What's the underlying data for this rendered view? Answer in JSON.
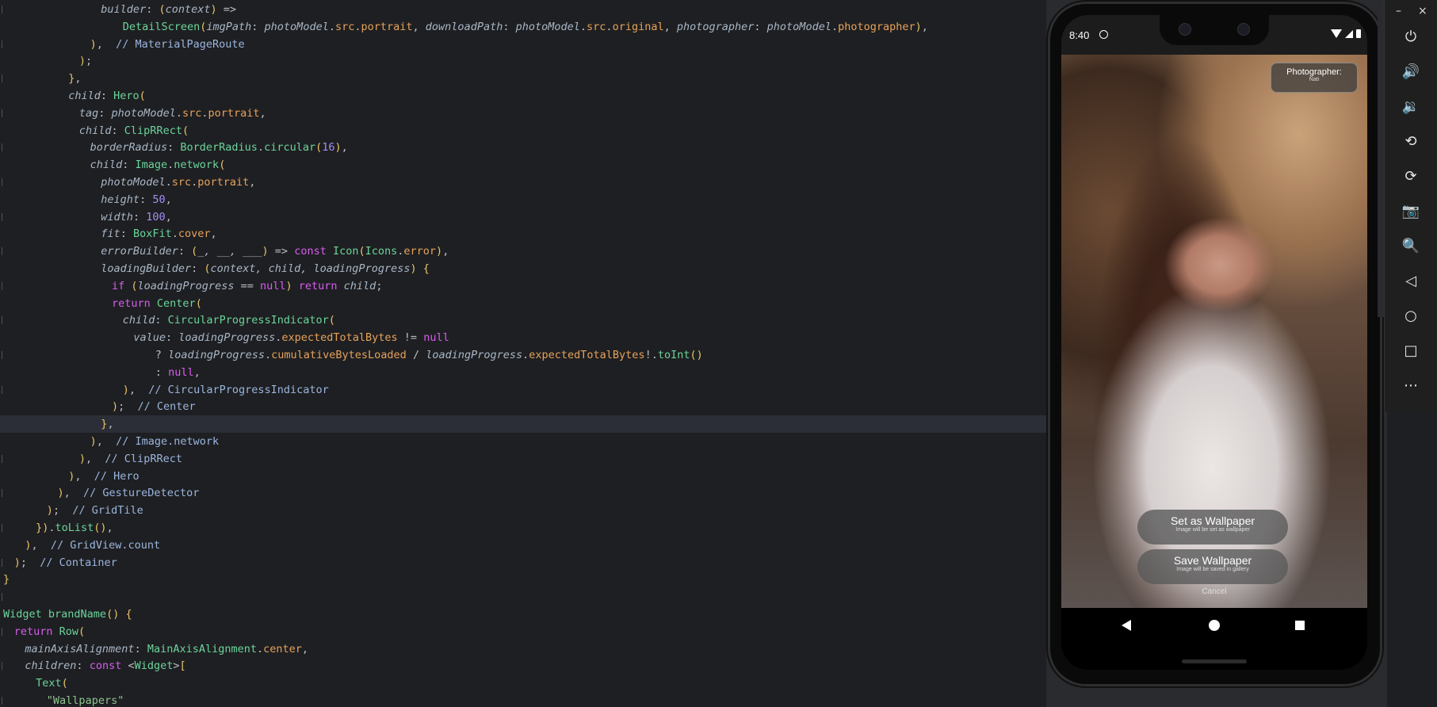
{
  "editor": {
    "lines": [
      {
        "indent": 9,
        "tokens": [
          [
            "p",
            "builder"
          ],
          [
            "i",
            ": "
          ],
          [
            "pa",
            "("
          ],
          [
            "p",
            "context"
          ],
          [
            "pa",
            ")"
          ],
          [
            "i",
            " =>"
          ]
        ]
      },
      {
        "indent": 11,
        "tokens": [
          [
            "c",
            "DetailScreen"
          ],
          [
            "pa",
            "("
          ],
          [
            "p",
            "imgPath"
          ],
          [
            "i",
            ": "
          ],
          [
            "p",
            "photoModel"
          ],
          [
            "i",
            "."
          ],
          [
            "f",
            "src"
          ],
          [
            "i",
            "."
          ],
          [
            "f",
            "portrait"
          ],
          [
            "i",
            ", "
          ],
          [
            "p",
            "downloadPath"
          ],
          [
            "i",
            ": "
          ],
          [
            "p",
            "photoModel"
          ],
          [
            "i",
            "."
          ],
          [
            "f",
            "src"
          ],
          [
            "i",
            "."
          ],
          [
            "f",
            "original"
          ],
          [
            "i",
            ", "
          ],
          [
            "p",
            "photographer"
          ],
          [
            "i",
            ": "
          ],
          [
            "p",
            "photoModel"
          ],
          [
            "i",
            "."
          ],
          [
            "f",
            "photographer"
          ],
          [
            "pa",
            ")"
          ],
          [
            "i",
            ","
          ]
        ]
      },
      {
        "indent": 8,
        "tokens": [
          [
            "pa",
            ")"
          ],
          [
            "i",
            ",  "
          ],
          [
            "cm",
            "// MaterialPageRoute"
          ]
        ]
      },
      {
        "indent": 7,
        "tokens": [
          [
            "pa",
            ")"
          ],
          [
            "i",
            ";"
          ]
        ]
      },
      {
        "indent": 6,
        "tokens": [
          [
            "pa",
            "}"
          ],
          [
            "i",
            ","
          ]
        ]
      },
      {
        "indent": 6,
        "tokens": [
          [
            "p",
            "child"
          ],
          [
            "i",
            ": "
          ],
          [
            "c",
            "Hero"
          ],
          [
            "pa",
            "("
          ]
        ]
      },
      {
        "indent": 7,
        "tokens": [
          [
            "p",
            "tag"
          ],
          [
            "i",
            ": "
          ],
          [
            "p",
            "photoModel"
          ],
          [
            "i",
            "."
          ],
          [
            "f",
            "src"
          ],
          [
            "i",
            "."
          ],
          [
            "f",
            "portrait"
          ],
          [
            "i",
            ","
          ]
        ]
      },
      {
        "indent": 7,
        "tokens": [
          [
            "p",
            "child"
          ],
          [
            "i",
            ": "
          ],
          [
            "c",
            "ClipRRect"
          ],
          [
            "pa",
            "("
          ]
        ]
      },
      {
        "indent": 8,
        "tokens": [
          [
            "p",
            "borderRadius"
          ],
          [
            "i",
            ": "
          ],
          [
            "c",
            "BorderRadius"
          ],
          [
            "i",
            "."
          ],
          [
            "c",
            "circular"
          ],
          [
            "pa",
            "("
          ],
          [
            "n",
            "16"
          ],
          [
            "pa",
            ")"
          ],
          [
            "i",
            ","
          ]
        ]
      },
      {
        "indent": 8,
        "tokens": [
          [
            "p",
            "child"
          ],
          [
            "i",
            ": "
          ],
          [
            "c",
            "Image"
          ],
          [
            "i",
            "."
          ],
          [
            "c",
            "network"
          ],
          [
            "pa",
            "("
          ]
        ]
      },
      {
        "indent": 9,
        "tokens": [
          [
            "p",
            "photoModel"
          ],
          [
            "i",
            "."
          ],
          [
            "f",
            "src"
          ],
          [
            "i",
            "."
          ],
          [
            "f",
            "portrait"
          ],
          [
            "i",
            ","
          ]
        ]
      },
      {
        "indent": 9,
        "tokens": [
          [
            "p",
            "height"
          ],
          [
            "i",
            ": "
          ],
          [
            "n",
            "50"
          ],
          [
            "i",
            ","
          ]
        ]
      },
      {
        "indent": 9,
        "tokens": [
          [
            "p",
            "width"
          ],
          [
            "i",
            ": "
          ],
          [
            "n",
            "100"
          ],
          [
            "i",
            ","
          ]
        ]
      },
      {
        "indent": 9,
        "tokens": [
          [
            "p",
            "fit"
          ],
          [
            "i",
            ": "
          ],
          [
            "c",
            "BoxFit"
          ],
          [
            "i",
            "."
          ],
          [
            "f",
            "cover"
          ],
          [
            "i",
            ","
          ]
        ]
      },
      {
        "indent": 9,
        "tokens": [
          [
            "p",
            "errorBuilder"
          ],
          [
            "i",
            ": "
          ],
          [
            "pa",
            "("
          ],
          [
            "p",
            "_, __, ___"
          ],
          [
            "pa",
            ")"
          ],
          [
            "i",
            " => "
          ],
          [
            "k",
            "const "
          ],
          [
            "c",
            "Icon"
          ],
          [
            "pa",
            "("
          ],
          [
            "c",
            "Icons"
          ],
          [
            "i",
            "."
          ],
          [
            "f",
            "error"
          ],
          [
            "pa",
            ")"
          ],
          [
            "i",
            ","
          ]
        ]
      },
      {
        "indent": 9,
        "tokens": [
          [
            "p",
            "loadingBuilder"
          ],
          [
            "i",
            ": "
          ],
          [
            "pa",
            "("
          ],
          [
            "p",
            "context, child, loadingProgress"
          ],
          [
            "pa",
            ")"
          ],
          [
            "i",
            " "
          ],
          [
            "pa",
            "{"
          ]
        ]
      },
      {
        "indent": 10,
        "tokens": [
          [
            "k",
            "if "
          ],
          [
            "pa",
            "("
          ],
          [
            "p",
            "loadingProgress"
          ],
          [
            "i",
            " == "
          ],
          [
            "k",
            "null"
          ],
          [
            "pa",
            ")"
          ],
          [
            "i",
            " "
          ],
          [
            "k",
            "return "
          ],
          [
            "p",
            "child"
          ],
          [
            "i",
            ";"
          ]
        ]
      },
      {
        "indent": 10,
        "tokens": [
          [
            "k",
            "return "
          ],
          [
            "c",
            "Center"
          ],
          [
            "pa",
            "("
          ]
        ]
      },
      {
        "indent": 11,
        "tokens": [
          [
            "p",
            "child"
          ],
          [
            "i",
            ": "
          ],
          [
            "c",
            "CircularProgressIndicator"
          ],
          [
            "pa",
            "("
          ]
        ]
      },
      {
        "indent": 12,
        "tokens": [
          [
            "p",
            "value"
          ],
          [
            "i",
            ": "
          ],
          [
            "p",
            "loadingProgress"
          ],
          [
            "i",
            "."
          ],
          [
            "f",
            "expectedTotalBytes"
          ],
          [
            "i",
            " != "
          ],
          [
            "k",
            "null"
          ]
        ]
      },
      {
        "indent": 14,
        "tokens": [
          [
            "i",
            "? "
          ],
          [
            "p",
            "loadingProgress"
          ],
          [
            "i",
            "."
          ],
          [
            "f",
            "cumulativeBytesLoaded"
          ],
          [
            "i",
            " / "
          ],
          [
            "p",
            "loadingProgress"
          ],
          [
            "i",
            "."
          ],
          [
            "f",
            "expectedTotalBytes"
          ],
          [
            "i",
            "!."
          ],
          [
            "c",
            "toInt"
          ],
          [
            "pa",
            "()"
          ]
        ]
      },
      {
        "indent": 14,
        "tokens": [
          [
            "i",
            ": "
          ],
          [
            "k",
            "null"
          ],
          [
            "i",
            ","
          ]
        ]
      },
      {
        "indent": 11,
        "tokens": [
          [
            "pa",
            ")"
          ],
          [
            "i",
            ",  "
          ],
          [
            "cm",
            "// CircularProgressIndicator"
          ]
        ]
      },
      {
        "indent": 10,
        "tokens": [
          [
            "pa",
            ")"
          ],
          [
            "i",
            ";  "
          ],
          [
            "cm",
            "// Center"
          ]
        ]
      },
      {
        "indent": 9,
        "tokens": [
          [
            "pa",
            "}"
          ],
          [
            "i",
            ","
          ]
        ]
      },
      {
        "indent": 8,
        "tokens": [
          [
            "pa",
            ")"
          ],
          [
            "i",
            ",  "
          ],
          [
            "cm",
            "// Image.network"
          ]
        ]
      },
      {
        "indent": 7,
        "tokens": [
          [
            "pa",
            ")"
          ],
          [
            "i",
            ",  "
          ],
          [
            "cm",
            "// ClipRRect"
          ]
        ]
      },
      {
        "indent": 6,
        "tokens": [
          [
            "pa",
            ")"
          ],
          [
            "i",
            ",  "
          ],
          [
            "cm",
            "// Hero"
          ]
        ]
      },
      {
        "indent": 5,
        "tokens": [
          [
            "pa",
            ")"
          ],
          [
            "i",
            ",  "
          ],
          [
            "cm",
            "// GestureDetector"
          ]
        ]
      },
      {
        "indent": 4,
        "tokens": [
          [
            "pa",
            ")"
          ],
          [
            "i",
            ";  "
          ],
          [
            "cm",
            "// GridTile"
          ]
        ]
      },
      {
        "indent": 3,
        "tokens": [
          [
            "pa",
            "})"
          ],
          [
            "i",
            "."
          ],
          [
            "c",
            "toList"
          ],
          [
            "pa",
            "()"
          ],
          [
            "i",
            ","
          ]
        ]
      },
      {
        "indent": 2,
        "tokens": [
          [
            "pa",
            ")"
          ],
          [
            "i",
            ",  "
          ],
          [
            "cm",
            "// GridView.count"
          ]
        ]
      },
      {
        "indent": 1,
        "tokens": [
          [
            "pa",
            ")"
          ],
          [
            "i",
            ";  "
          ],
          [
            "cm",
            "// Container"
          ]
        ]
      },
      {
        "indent": 0,
        "tokens": [
          [
            "pa",
            "}"
          ]
        ]
      },
      {
        "indent": 0,
        "tokens": []
      },
      {
        "indent": 0,
        "tokens": [
          [
            "c",
            "Widget "
          ],
          [
            "c",
            "brandName"
          ],
          [
            "pa",
            "()"
          ],
          [
            "i",
            " "
          ],
          [
            "pa",
            "{"
          ]
        ]
      },
      {
        "indent": 1,
        "tokens": [
          [
            "k",
            "return "
          ],
          [
            "c",
            "Row"
          ],
          [
            "pa",
            "("
          ]
        ]
      },
      {
        "indent": 2,
        "tokens": [
          [
            "p",
            "mainAxisAlignment"
          ],
          [
            "i",
            ": "
          ],
          [
            "c",
            "MainAxisAlignment"
          ],
          [
            "i",
            "."
          ],
          [
            "f",
            "center"
          ],
          [
            "i",
            ","
          ]
        ]
      },
      {
        "indent": 2,
        "tokens": [
          [
            "p",
            "children"
          ],
          [
            "i",
            ": "
          ],
          [
            "k",
            "const "
          ],
          [
            "i",
            "<"
          ],
          [
            "c",
            "Widget"
          ],
          [
            "i",
            ">"
          ],
          [
            "pa",
            "["
          ]
        ]
      },
      {
        "indent": 3,
        "tokens": [
          [
            "c",
            "Text"
          ],
          [
            "pa",
            "("
          ]
        ]
      },
      {
        "indent": 4,
        "tokens": [
          [
            "s",
            "\"Wallpapers\""
          ]
        ]
      }
    ],
    "highlighted_line": 24
  },
  "phone": {
    "time": "8:40",
    "photographer_label": "Photographer:",
    "photographer_name": "Nati",
    "set_wallpaper_title": "Set as Wallpaper",
    "set_wallpaper_sub": "Image will be set as wallpaper",
    "save_wallpaper_title": "Save Wallpaper",
    "save_wallpaper_sub": "Image will be saved in gallery",
    "cancel_label": "Cancel"
  },
  "toolbar": {
    "minimize_label": "–",
    "close_label": "×",
    "buttons": [
      {
        "name": "power-icon",
        "glyph": "⏻"
      },
      {
        "name": "volume-up-icon",
        "glyph": "🔊"
      },
      {
        "name": "volume-down-icon",
        "glyph": "🔉"
      },
      {
        "name": "rotate-left-icon",
        "glyph": "⟲"
      },
      {
        "name": "rotate-right-icon",
        "glyph": "⟳"
      },
      {
        "name": "camera-icon",
        "glyph": "📷"
      },
      {
        "name": "zoom-icon",
        "glyph": "🔍"
      },
      {
        "name": "back-icon",
        "glyph": "◁"
      },
      {
        "name": "home-icon",
        "glyph": "○"
      },
      {
        "name": "overview-icon",
        "glyph": "□"
      },
      {
        "name": "more-icon",
        "glyph": "⋯"
      }
    ]
  }
}
